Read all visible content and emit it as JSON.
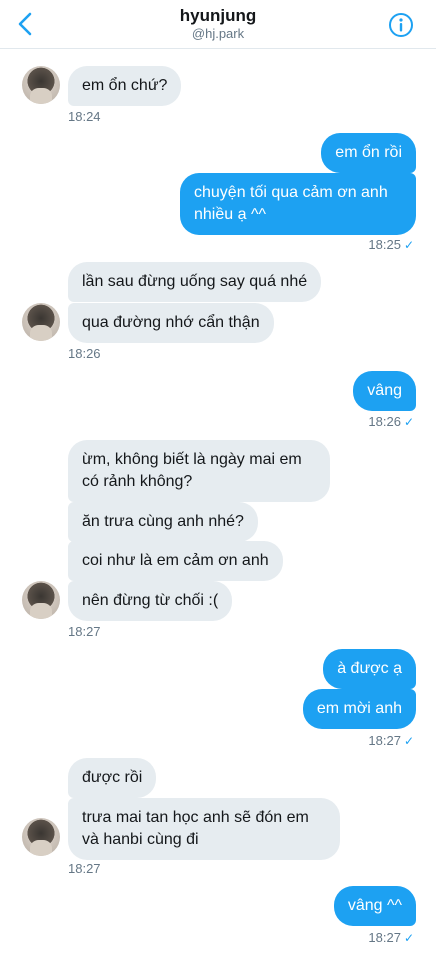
{
  "header": {
    "title": "hyunjung",
    "handle": "@hj.park",
    "back_icon": "chevron-left-icon",
    "info_icon": "info-icon",
    "accent": "#1da1f2"
  },
  "messages": [
    {
      "text": "em ổn chứ?"
    },
    {
      "text": "em ổn rồi"
    },
    {
      "text": "chuyện tối qua cảm ơn anh\nnhiều ạ ^^"
    },
    {
      "text": "lần sau đừng uống say quá nhé"
    },
    {
      "text": "qua đường nhớ cẩn thận"
    },
    {
      "text": "vâng"
    },
    {
      "text": "ừm, không biết là ngày mai em\ncó rảnh không?"
    },
    {
      "text": "ăn trưa cùng anh nhé?"
    },
    {
      "text": "coi như là em cảm ơn anh"
    },
    {
      "text": "nên đừng từ chối :("
    },
    {
      "text": "à được ạ"
    },
    {
      "text": "em mời anh"
    },
    {
      "text": "được rồi"
    },
    {
      "text": "trưa mai tan học anh sẽ đón em\nvà hanbi cùng đi"
    },
    {
      "text": "vâng ^^"
    }
  ],
  "timestamps": [
    {
      "time": "18:24"
    },
    {
      "time": "18:25",
      "read": "✓"
    },
    {
      "time": "18:26"
    },
    {
      "time": "18:26",
      "read": "✓"
    },
    {
      "time": "18:27"
    },
    {
      "time": "18:27",
      "read": "✓"
    },
    {
      "time": "18:27"
    },
    {
      "time": "18:27",
      "read": "✓"
    }
  ]
}
